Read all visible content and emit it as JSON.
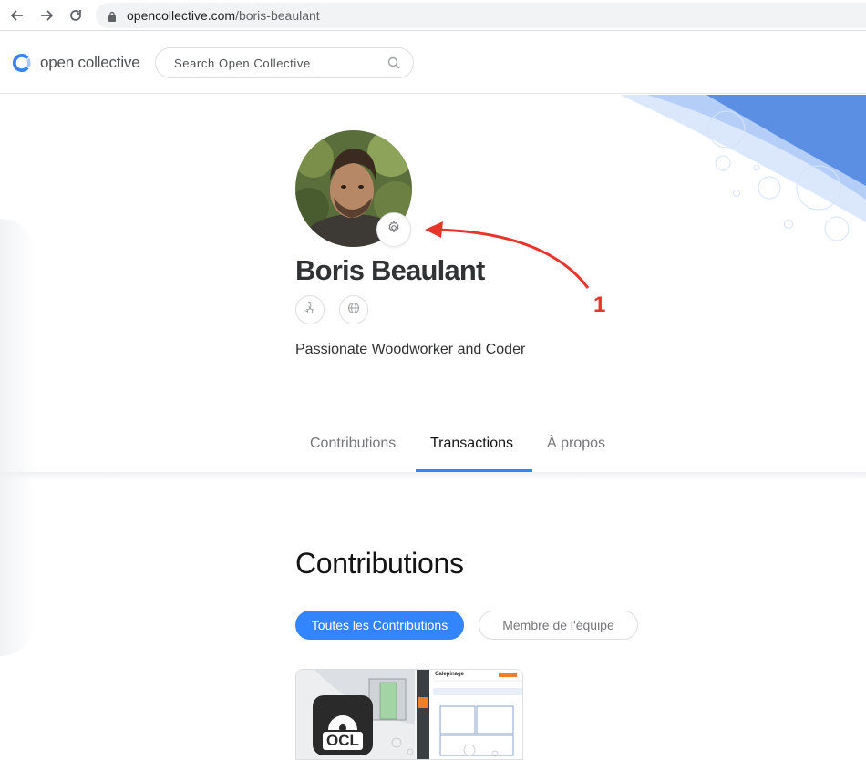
{
  "browser": {
    "url_host": "opencollective.com",
    "url_path": "/boris-beaulant",
    "icons": [
      "back-arrow-icon",
      "forward-arrow-icon",
      "reload-icon",
      "lock-icon"
    ]
  },
  "topnav": {
    "logo_text": "open collective",
    "search_placeholder": "Search Open Collective"
  },
  "profile": {
    "name": "Boris Beaulant",
    "tagline": "Passionate Woodworker and Coder",
    "social_icons": [
      "github-icon",
      "globe-icon"
    ]
  },
  "annotation": {
    "number": "1",
    "color": "#e8352a"
  },
  "tabs": [
    {
      "label": "Contributions",
      "active": false
    },
    {
      "label": "Transactions",
      "active": true
    },
    {
      "label": "À propos",
      "active": false
    }
  ],
  "contributions": {
    "title": "Contributions",
    "filters": [
      {
        "label": "Toutes les Contributions",
        "selected": true
      },
      {
        "label": "Membre de l'équipe",
        "selected": false
      }
    ],
    "card": {
      "logo_text": "OCL",
      "app_title": "Calepinage"
    }
  },
  "colors": {
    "accent": "#3385ff",
    "text_dark": "#313233",
    "text_muted": "#76777a"
  }
}
